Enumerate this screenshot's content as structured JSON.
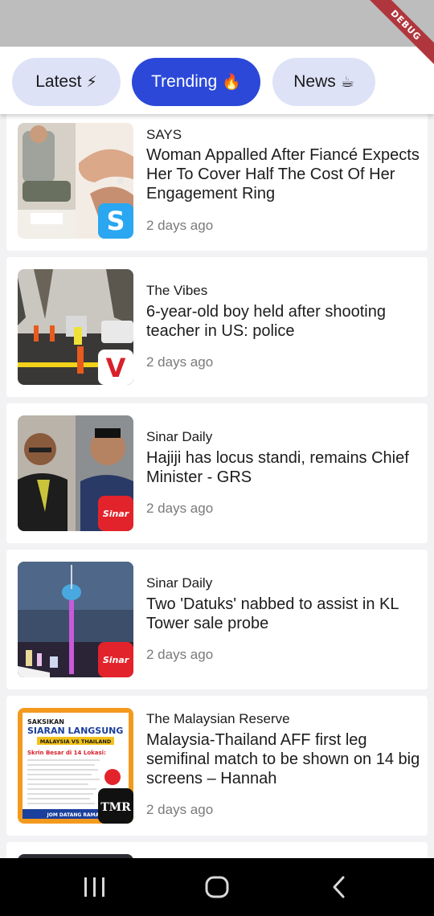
{
  "tabs": [
    {
      "label": "Latest",
      "emoji": "⚡",
      "active": false
    },
    {
      "label": "Trending",
      "emoji": "🔥",
      "active": true
    },
    {
      "label": "News",
      "emoji": "☕",
      "active": false
    }
  ],
  "debug_banner": "DEBUG",
  "articles": [
    {
      "source": "SAYS",
      "title": "Woman Appalled After Fiancé Expects Her To Cover Half The Cost Of Her Engagement Ring",
      "time": "2 days ago",
      "badge_text": "S",
      "badge_color": "#2aa7f0"
    },
    {
      "source": "The Vibes",
      "title": "6-year-old boy held after shooting teacher in US: police",
      "time": "2 days ago",
      "badge_text": "V",
      "badge_color": "#ffffff"
    },
    {
      "source": "Sinar Daily",
      "title": "Hajiji has locus standi, remains Chief Minister - GRS",
      "time": "2 days ago",
      "badge_text": "Sinar",
      "badge_color": "#e3232b"
    },
    {
      "source": "Sinar Daily",
      "title": "Two 'Datuks' nabbed to assist in KL Tower sale probe",
      "time": "2 days ago",
      "badge_text": "Sinar",
      "badge_color": "#e3232b"
    },
    {
      "source": "The Malaysian Reserve",
      "title": "Malaysia-Thailand AFF first leg semifinal match to be shown on 14 big screens – Hannah",
      "time": "2 days ago",
      "badge_text": "TMR",
      "badge_color": "#111111"
    }
  ],
  "poster": {
    "heading1": "SAKSIKAN",
    "heading2": "SIARAN LANGSUNG",
    "teams": "MALAYSIA VS THAILAND",
    "screens": "Skrin Besar di 14 Lokasi:",
    "footer": "JOM DATANG RAMAI"
  },
  "colors": {
    "accent": "#2b48d9",
    "tab_inactive": "#dde2f7",
    "statusbar": "#bdbdbd"
  }
}
